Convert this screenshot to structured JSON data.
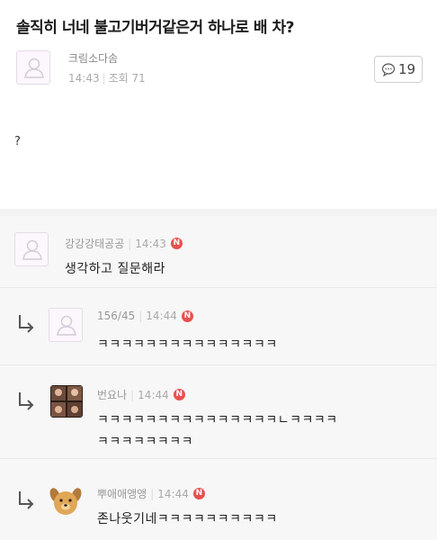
{
  "post": {
    "title": "솔직히 너네 불고기버거같은거 하나로 배 차?",
    "author": "크림소다솜",
    "time": "14:43",
    "views_label": "조회 71",
    "comment_count": "19",
    "body": "?"
  },
  "comments": [
    {
      "author": "강강강태공공",
      "time": "14:43",
      "badge": "N",
      "text": "생각하고 질문해라",
      "is_reply": false,
      "avatar": "default-avatar-icon"
    },
    {
      "author": "156/45",
      "time": "14:44",
      "badge": "N",
      "text": "ㅋㅋㅋㅋㅋㅋㅋㅋㅋㅋㅋㅋㅋㅋㅋ",
      "is_reply": true,
      "avatar": "default-avatar-icon"
    },
    {
      "author": "번요나",
      "time": "14:44",
      "badge": "N",
      "text_line1": "ㅋㅋㅋㅋㅋㅋㅋㅋㅋㅋㅋㅋㅋㅋㅋㄴㅋㅋㅋㅋ",
      "text_line2": "ㅋㅋㅋㅋㅋㅋㅋㅋ",
      "is_reply": true,
      "avatar": "photo-avatar"
    },
    {
      "author": "뿌애애앵앵",
      "time": "14:44",
      "badge": "N",
      "text": "존나웃기네ㅋㅋㅋㅋㅋㅋㅋㅋㅋㅋ",
      "is_reply": true,
      "avatar": "dog-avatar"
    }
  ],
  "colors": {
    "badge": "#e8504f",
    "comment_bg": "#f7f7f7",
    "meta_text": "#999999"
  }
}
